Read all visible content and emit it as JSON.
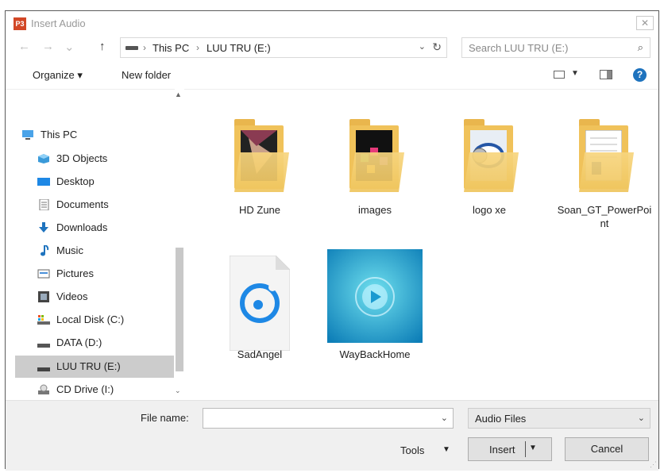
{
  "window": {
    "title": "Insert Audio",
    "app_icon": "P3",
    "close_glyph": "✕"
  },
  "nav": {
    "back_icon": "←",
    "forward_icon": "→",
    "up_icon": "↑",
    "breadcrumbs": [
      "This PC",
      "LUU TRU (E:)"
    ],
    "crumb_sep": "›",
    "dropdown_glyph": "⌄",
    "refresh_glyph": "↻",
    "search_placeholder": "Search LUU TRU (E:)",
    "search_glyph": "⌕"
  },
  "toolbar": {
    "organize": "Organize ▾",
    "new_folder": "New folder",
    "help": "?"
  },
  "sidebar": {
    "items": [
      {
        "label": "This PC",
        "icon": "pc-icon"
      },
      {
        "label": "3D Objects",
        "icon": "3d-objects-icon"
      },
      {
        "label": "Desktop",
        "icon": "desktop-icon"
      },
      {
        "label": "Documents",
        "icon": "documents-icon"
      },
      {
        "label": "Downloads",
        "icon": "downloads-icon"
      },
      {
        "label": "Music",
        "icon": "music-icon"
      },
      {
        "label": "Pictures",
        "icon": "pictures-icon"
      },
      {
        "label": "Videos",
        "icon": "videos-icon"
      },
      {
        "label": "Local Disk (C:)",
        "icon": "local-disk-icon"
      },
      {
        "label": "DATA (D:)",
        "icon": "drive-icon"
      },
      {
        "label": "LUU TRU (E:)",
        "icon": "drive-icon",
        "selected": true
      },
      {
        "label": "CD Drive (I:)",
        "icon": "cd-drive-icon"
      }
    ]
  },
  "files": [
    {
      "name": "HD Zune",
      "type": "folder"
    },
    {
      "name": "images",
      "type": "folder"
    },
    {
      "name": "logo xe",
      "type": "folder"
    },
    {
      "name": "Soan_GT_PowerPoint",
      "type": "folder"
    },
    {
      "name": "SadAngel",
      "type": "audio-file"
    },
    {
      "name": "WayBackHome",
      "type": "audio-file"
    }
  ],
  "footer": {
    "file_name_label": "File name:",
    "file_name_value": "",
    "file_type": "Audio Files",
    "tools": "Tools",
    "insert": "Insert",
    "cancel": "Cancel"
  },
  "colors": {
    "accent": "#1e73be",
    "folder": "#f0c25a",
    "selected_row": "#cccccc"
  }
}
